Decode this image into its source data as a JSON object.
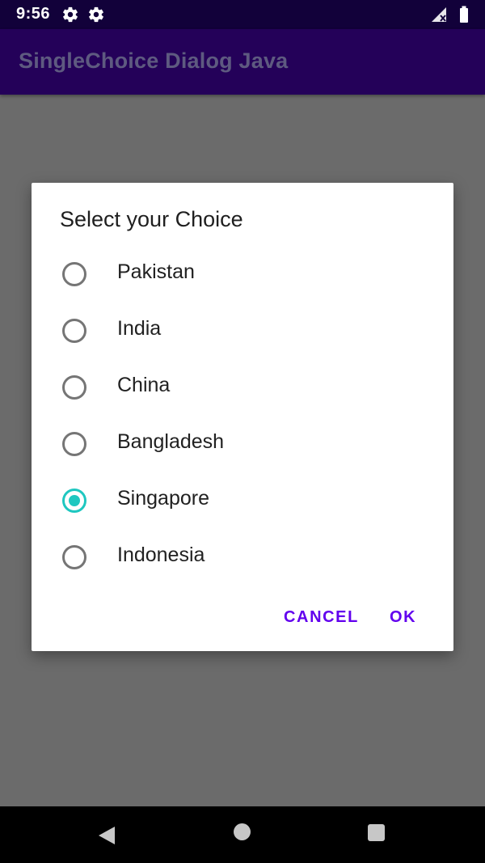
{
  "status_bar": {
    "time": "9:56",
    "icons": [
      "gear-icon",
      "gear-icon",
      "signal-icon",
      "battery-icon"
    ]
  },
  "app_bar": {
    "title": "SingleChoice Dialog Java"
  },
  "dialog": {
    "title": "Select your Choice",
    "options": [
      {
        "label": "Pakistan",
        "selected": false
      },
      {
        "label": "India",
        "selected": false
      },
      {
        "label": "China",
        "selected": false
      },
      {
        "label": "Bangladesh",
        "selected": false
      },
      {
        "label": "Singapore",
        "selected": true
      },
      {
        "label": "Indonesia",
        "selected": false
      }
    ],
    "cancel_label": "CANCEL",
    "ok_label": "OK"
  },
  "nav_bar": {
    "icons": [
      "back-icon",
      "home-icon",
      "recents-icon"
    ]
  },
  "colors": {
    "accent": "#6200ee",
    "radio_selected": "#1ec7c0",
    "app_bar": "#240159",
    "status_bar": "#12013a",
    "scrim_background": "#6b6b6b"
  }
}
